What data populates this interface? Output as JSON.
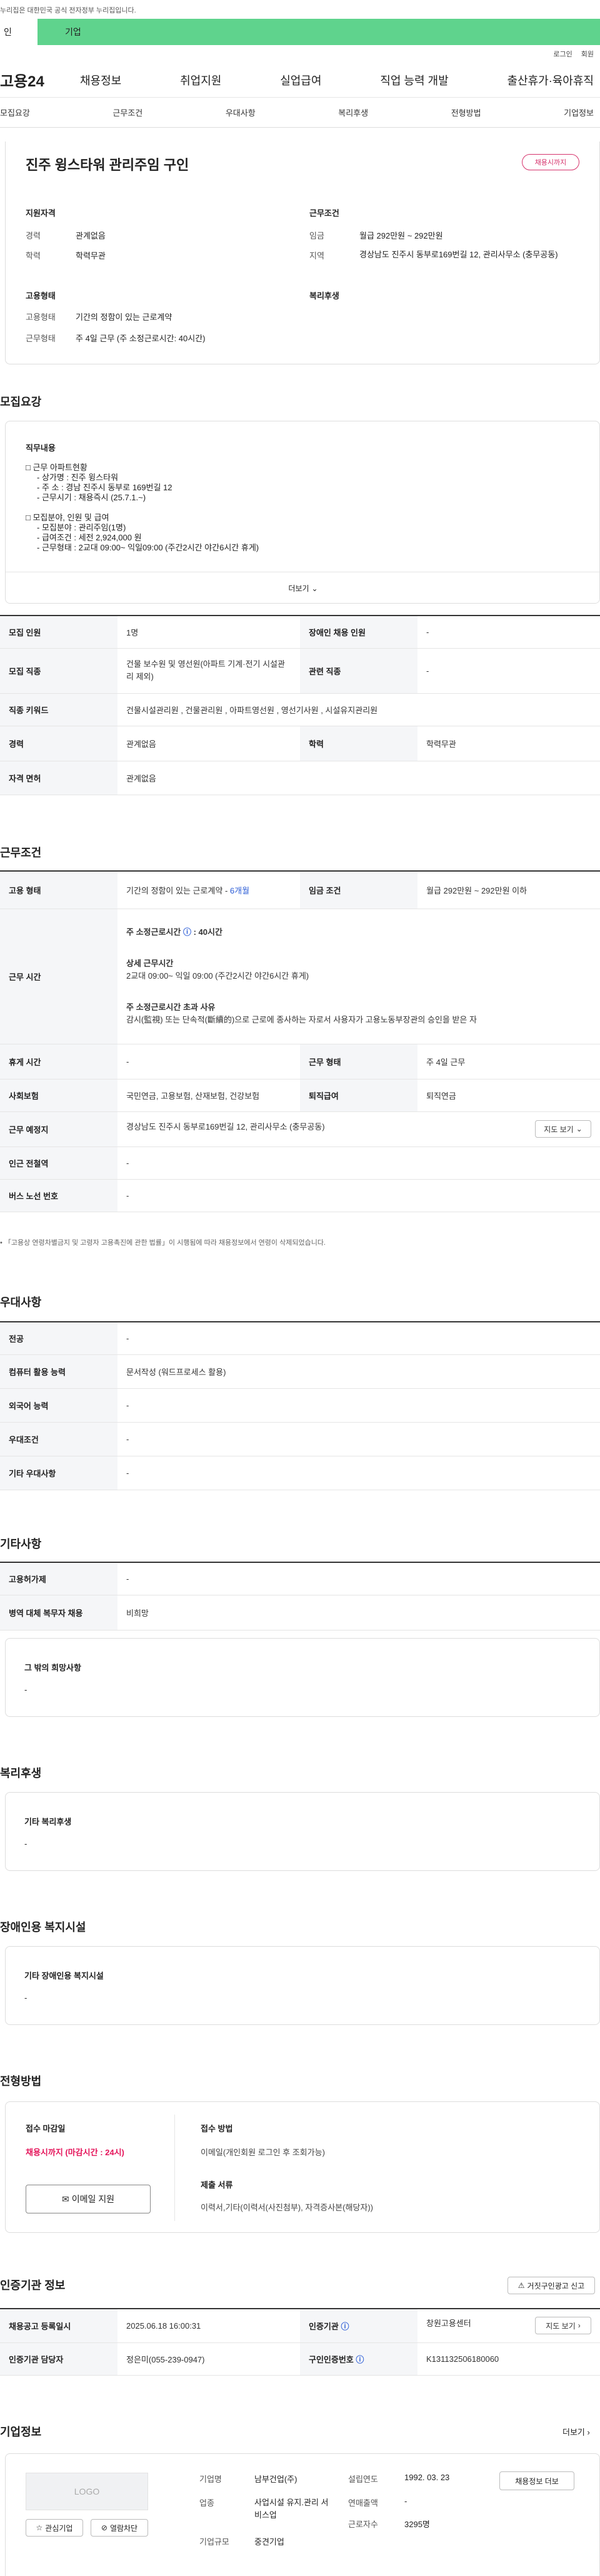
{
  "gov_banner": "누리집은 대한민국 공식 전자정부 누리집입니다.",
  "top_tabs": {
    "personal": "인",
    "company": "기업"
  },
  "util": {
    "login": "로그인",
    "join": "회원"
  },
  "gnb": {
    "logo": "고용24",
    "menu": [
      "채용정보",
      "취업지원",
      "실업급여",
      "직업 능력 개발",
      "출산휴가·육아휴직"
    ]
  },
  "subnav": [
    "모집요강",
    "근무조건",
    "우대사항",
    "복리후생",
    "전형방법",
    "기업정보"
  ],
  "job": {
    "title": "진주 윙스타워 관리주임 구인",
    "badge": "채용시까지",
    "summary": {
      "qual_title": "지원자격",
      "career_label": "경력",
      "career": "관계없음",
      "edu_label": "학력",
      "edu": "학력무관",
      "cond_title": "근무조건",
      "wage_label": "임금",
      "wage": "월급 292만원 ~ 292만원",
      "area_label": "지역",
      "area": "경상남도 진주시 동부로169번길 12, 관리사무소 (충무공동)",
      "emp_title": "고용형태",
      "etype_label": "고용형태",
      "etype": "기간의 정함이 있는 근로계약",
      "wtype_label": "근무형태",
      "wtype": "주 4일 근무 (주 소정근로시간: 40시간)",
      "welfare_title": "복리후생"
    }
  },
  "recruit": {
    "title": "모집요강",
    "duty_title": "직무내용",
    "duty_lines": [
      "□ 근무 아파트현황",
      "- 상가명 : 진주 윙스타워",
      "- 주 소 : 경남 진주시 동부로 169번길 12",
      "- 근무시기 : 채용즉시 (25.7.1.~)",
      "",
      "□ 모집분야, 인원 및 급여",
      "- 모집분야 : 관리주임(1명)",
      "- 급여조건 : 세전 2,924,000 원",
      "- 근무형태 : 2교대 09:00~ 익일09:00 (주간2시간 야간6시간 휴게)"
    ],
    "more": "더보기",
    "rows": [
      [
        "모집 인원",
        "1명",
        "장애인 채용 인원",
        "-"
      ],
      [
        "모집 직종",
        "건물 보수원 및 영선원(아파트 기계·전기 시설관리 제외)",
        "관련 직종",
        "-"
      ],
      [
        "직종 키워드",
        "건물시설관리원 , 건물관리원 , 아파트영선원 , 영선기사원 , 시설유지관리원"
      ],
      [
        "경력",
        "관계없음",
        "학력",
        "학력무관"
      ],
      [
        "자격 면허",
        "관계없음"
      ]
    ]
  },
  "conditions": {
    "title": "근무조건",
    "etype_h": "고용 형태",
    "etype": "기간의 정함이 있는 근로계약 - ",
    "etype_period": "6개월",
    "wage_h": "임금 조건",
    "wage": "월급 292만원 ~ 292만원 이하",
    "hours_h": "근무 시간",
    "hours_title": "주 소정근로시간",
    "hours_value": "40시간",
    "detail_title": "상세 근무시간",
    "detail": "2교대 09:00~ 익일 09:00 (주간2시간 야간6시간 휴게)",
    "excess_title": "주 소정근로시간 초과 사유",
    "excess": "감시(監視) 또는 단속적(斷續的)으로 근로에 종사하는 자로서 사용자가 고용노동부장관의 승인을 받은 자",
    "break_h": "휴게 시간",
    "break": "-",
    "wtype_h": "근무 형태",
    "wtype": "주 4일 근무",
    "ins_h": "사회보험",
    "ins": "국민연금, 고용보험, 산재보험, 건강보험",
    "sev_h": "퇴직급여",
    "sev": "퇴직연금",
    "loc_h": "근무 예정지",
    "loc": "경상남도 진주시 동부로169번길 12, 관리사무소 (충무공동)",
    "map_btn": "지도 보기",
    "subway_h": "인근 전철역",
    "subway": "-",
    "bus_h": "버스 노선 번호",
    "bus": "-",
    "note": "「고용상 연령차별금지 및 고령자 고용촉진에 관한 법률」이 시행됨에 따라 채용정보에서 연령이 삭제되었습니다."
  },
  "pref": {
    "title": "우대사항",
    "rows": [
      [
        "전공",
        "-"
      ],
      [
        "컴퓨터 활용 능력",
        "문서작성 (워드프로세스 활용)"
      ],
      [
        "외국어 능력",
        "-"
      ],
      [
        "우대조건",
        "-"
      ],
      [
        "기타 우대사항",
        "-"
      ]
    ]
  },
  "etc": {
    "title": "기타사항",
    "rows": [
      [
        "고용허가제",
        "-"
      ],
      [
        "병역 대체 복무자 채용",
        "비희망"
      ]
    ],
    "box_title": "그 밖의 희망사항",
    "box_value": "-"
  },
  "welfare": {
    "title": "복리후생",
    "box_title": "기타 복리후생",
    "box_value": "-"
  },
  "disability": {
    "title": "장애인용 복지시설",
    "box_title": "기타 장애인용 복지시설",
    "box_value": "-"
  },
  "process": {
    "title": "전형방법",
    "deadline_title": "접수 마감일",
    "deadline": "채용시까지 (마감시간 : 24시)",
    "email_btn": "이메일 지원",
    "method_title": "접수 방법",
    "method": "이메일(개인회원 로그인 후 조회가능)",
    "docs_title": "제출 서류",
    "docs": "이력서,기타(이력서(사진첨부), 자격증사본(해당자))"
  },
  "agency": {
    "title": "인증기관 정보",
    "report_btn": "거짓구인광고 신고",
    "rows": [
      [
        "채용공고 등록일시",
        "2025.06.18 16:00:31",
        "인증기관",
        "창원고용센터"
      ],
      [
        "인증기관 담당자",
        "정은미(055-239-0947)",
        "구인인증번호",
        "K131132506180060"
      ]
    ],
    "map_btn": "지도 보기"
  },
  "company": {
    "title": "기업정보",
    "more": "더보기",
    "logo": "LOGO",
    "fav_btn": "관심기업",
    "block_btn": "열람차단",
    "all_btn": "채용정보 더보",
    "name_label": "기업명",
    "name": "남부건업(주)",
    "industry_label": "업종",
    "industry": "사업시설 유지.관리 서비스업",
    "size_label": "기업규모",
    "size": "중견기업",
    "founded_label": "설립연도",
    "founded": "1992. 03. 23",
    "sales_label": "연매출액",
    "sales": "-",
    "emp_label": "근로자수",
    "emp": "3295명"
  }
}
